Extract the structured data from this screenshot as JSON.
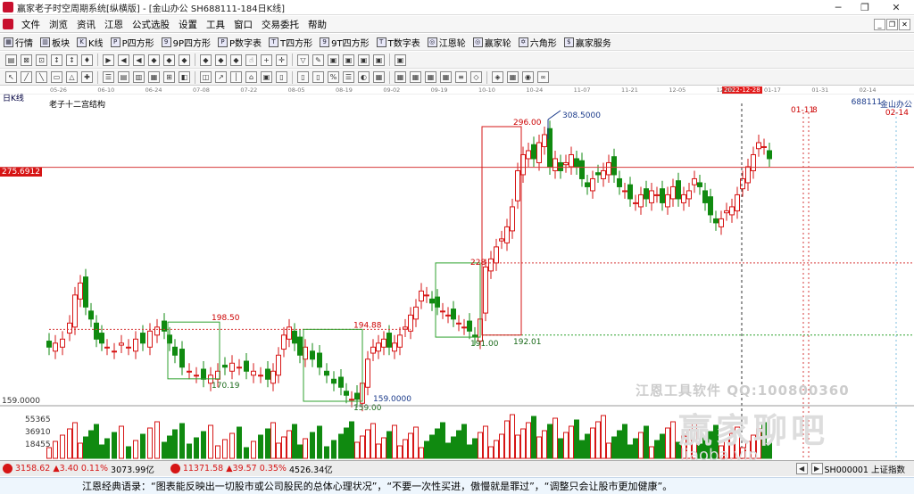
{
  "window": {
    "title": "赢家老子时空周期系统[纵横版] - [金山办公  SH688111-184日K线]",
    "min_label": "─",
    "restore_label": "❐",
    "close_label": "✕"
  },
  "menu": [
    "文件",
    "浏览",
    "资讯",
    "江恩",
    "公式选股",
    "设置",
    "工具",
    "窗口",
    "交易委托",
    "帮助"
  ],
  "toolbar1": [
    {
      "icon": "▦",
      "label": "行情"
    },
    {
      "icon": "▥",
      "label": "板块"
    },
    {
      "icon": "K",
      "label": "K线"
    },
    {
      "icon": "P",
      "label": "P四方形"
    },
    {
      "icon": "9",
      "label": "9P四方形"
    },
    {
      "icon": "P",
      "label": "P数字表"
    },
    {
      "icon": "T",
      "label": "T四方形"
    },
    {
      "icon": "9",
      "label": "9T四方形"
    },
    {
      "icon": "T",
      "label": "T数字表"
    },
    {
      "icon": "◎",
      "label": "江恩轮"
    },
    {
      "icon": "◎",
      "label": "赢家轮"
    },
    {
      "icon": "✡",
      "label": "六角形"
    },
    {
      "icon": "$",
      "label": "赢家服务"
    }
  ],
  "toolbar2_icons": [
    "▤",
    "⊠",
    "⊡",
    "↕",
    "↕",
    "♦",
    "▶",
    "◀",
    "◀",
    "◆",
    "◆",
    "◆",
    "◆",
    "◆",
    "◆",
    "☝",
    "+",
    "✛",
    "▽",
    "✎",
    "▣",
    "▣",
    "▣",
    "▣",
    "▣"
  ],
  "toolbar3_icons": [
    "↖",
    "╱",
    "╲",
    "▭",
    "△",
    "✚",
    "☰",
    "▤",
    "▥",
    "▦",
    "⊞",
    "◧",
    "◫",
    "↗",
    "│",
    "⌂",
    "▣",
    "▯",
    "▯",
    "▯",
    "%",
    "☰",
    "◐",
    "▦",
    "▦",
    "▦",
    "▦",
    "▦",
    "≡",
    "◇",
    "◈",
    "▦",
    "◉",
    "∞"
  ],
  "date_axis": {
    "ticks": [
      "05-26",
      "06-10",
      "06-24",
      "07-08",
      "07-22",
      "08-05",
      "08-19",
      "09-02",
      "09-19",
      "10-10",
      "10-24",
      "11-07",
      "11-21",
      "12-05",
      "12-19",
      "01-17",
      "01-31",
      "02-14"
    ],
    "current": "2022-12-28"
  },
  "chart_labels": {
    "period": "日K线",
    "indicator": "老子十二宫结构",
    "stock_code": "688111",
    "stock_name": "金山办公",
    "right_date": "02-14",
    "current_price": "275.6912",
    "box_date": "01-11",
    "box_date2": "8"
  },
  "colors": {
    "up": "#d61515",
    "down": "#108a10",
    "box_green": "#2fa22f",
    "box_red": "#d61515",
    "hline": "#d63a3a",
    "guide_blue": "#1a3a8a",
    "accent_red": "#e21b1b"
  },
  "chart_data": {
    "type": "candlestick",
    "price_scale": {
      "min": 159.0,
      "max": 308.5
    },
    "annotations": [
      {
        "label": "198.50",
        "value": 198.5
      },
      {
        "label": "194.88",
        "value": 194.88
      },
      {
        "label": "170.19",
        "value": 170.19
      },
      {
        "label": "159.0000",
        "value": 159.0
      },
      {
        "label": "159.00",
        "value": 159.0
      },
      {
        "label": "191.00",
        "value": 191.0
      },
      {
        "label": "192.01",
        "value": 192.01
      },
      {
        "label": "228",
        "value": 228
      },
      {
        "label": "296.00",
        "value": 296.0
      },
      {
        "label": "308.5000",
        "value": 308.5
      }
    ],
    "y_tick": "159.0000",
    "volume_ticks": [
      "55365",
      "36910",
      "18455"
    ]
  },
  "watermarks": {
    "software": "江恩工具软件  QQ:100800360",
    "brand": "赢家聊吧",
    "url": "liaoba.vip"
  },
  "bottom_bar": {
    "sh_index": "3158.62",
    "sh_change": "▲3.40",
    "sh_pct": "0.11%",
    "sh_amount": "3073.99亿",
    "sz_index": "11371.58",
    "sz_change": "▲39.57",
    "sz_pct": "0.35%",
    "sz_amount": "4526.34亿",
    "right_label": "SH000001 上证指数"
  },
  "quote": "江恩经典语录：“图表能反映出一切股市或公司股民的总体心理状况”，“不要一次性买进，傲慢就是罪过”，“调整只会让股市更加健康”。"
}
